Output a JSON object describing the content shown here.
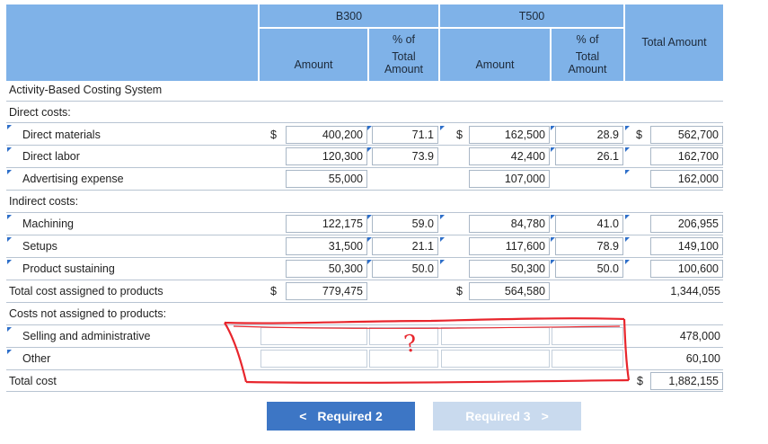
{
  "headers": {
    "b300": "B300",
    "t500": "T500",
    "amount": "Amount",
    "pct_line1": "% of",
    "pct_line2": "Total",
    "pct_line3": "Amount",
    "total_amount": "Total Amount"
  },
  "rows": [
    {
      "label": "Activity-Based Costing System"
    },
    {
      "label": "Direct costs:"
    },
    {
      "label": "Direct materials",
      "b300_amount": "400,200",
      "b300_pct": "71.1",
      "t500_amount": "162,500",
      "t500_pct": "28.9",
      "total": "562,700"
    },
    {
      "label": "Direct labor",
      "b300_amount": "120,300",
      "b300_pct": "73.9",
      "t500_amount": "42,400",
      "t500_pct": "26.1",
      "total": "162,700"
    },
    {
      "label": "Advertising expense",
      "b300_amount": "55,000",
      "b300_pct": "",
      "t500_amount": "107,000",
      "t500_pct": "",
      "total": "162,000"
    },
    {
      "label": "Indirect costs:"
    },
    {
      "label": "Machining",
      "b300_amount": "122,175",
      "b300_pct": "59.0",
      "t500_amount": "84,780",
      "t500_pct": "41.0",
      "total": "206,955"
    },
    {
      "label": "Setups",
      "b300_amount": "31,500",
      "b300_pct": "21.1",
      "t500_amount": "117,600",
      "t500_pct": "78.9",
      "total": "149,100"
    },
    {
      "label": "Product sustaining",
      "b300_amount": "50,300",
      "b300_pct": "50.0",
      "t500_amount": "50,300",
      "t500_pct": "50.0",
      "total": "100,600"
    },
    {
      "label": "Total cost assigned to products",
      "b300_amount": "779,475",
      "t500_amount": "564,580",
      "total": "1,344,055"
    },
    {
      "label": "Costs not assigned to products:"
    },
    {
      "label": "Selling and administrative",
      "total": "478,000"
    },
    {
      "label": "Other",
      "total": "60,100"
    },
    {
      "label": "Total cost",
      "total": "1,882,155"
    }
  ],
  "currency": "$",
  "annotation": "?",
  "nav": {
    "prev_label": "Required 2",
    "next_label": "Required 3",
    "prev_arrow": "<",
    "next_arrow": ">"
  },
  "colors": {
    "header_bg": "#7fb2e8",
    "button_active": "#3d76c5",
    "button_disabled": "#c9daee",
    "annotation_red": "#e8262d"
  }
}
